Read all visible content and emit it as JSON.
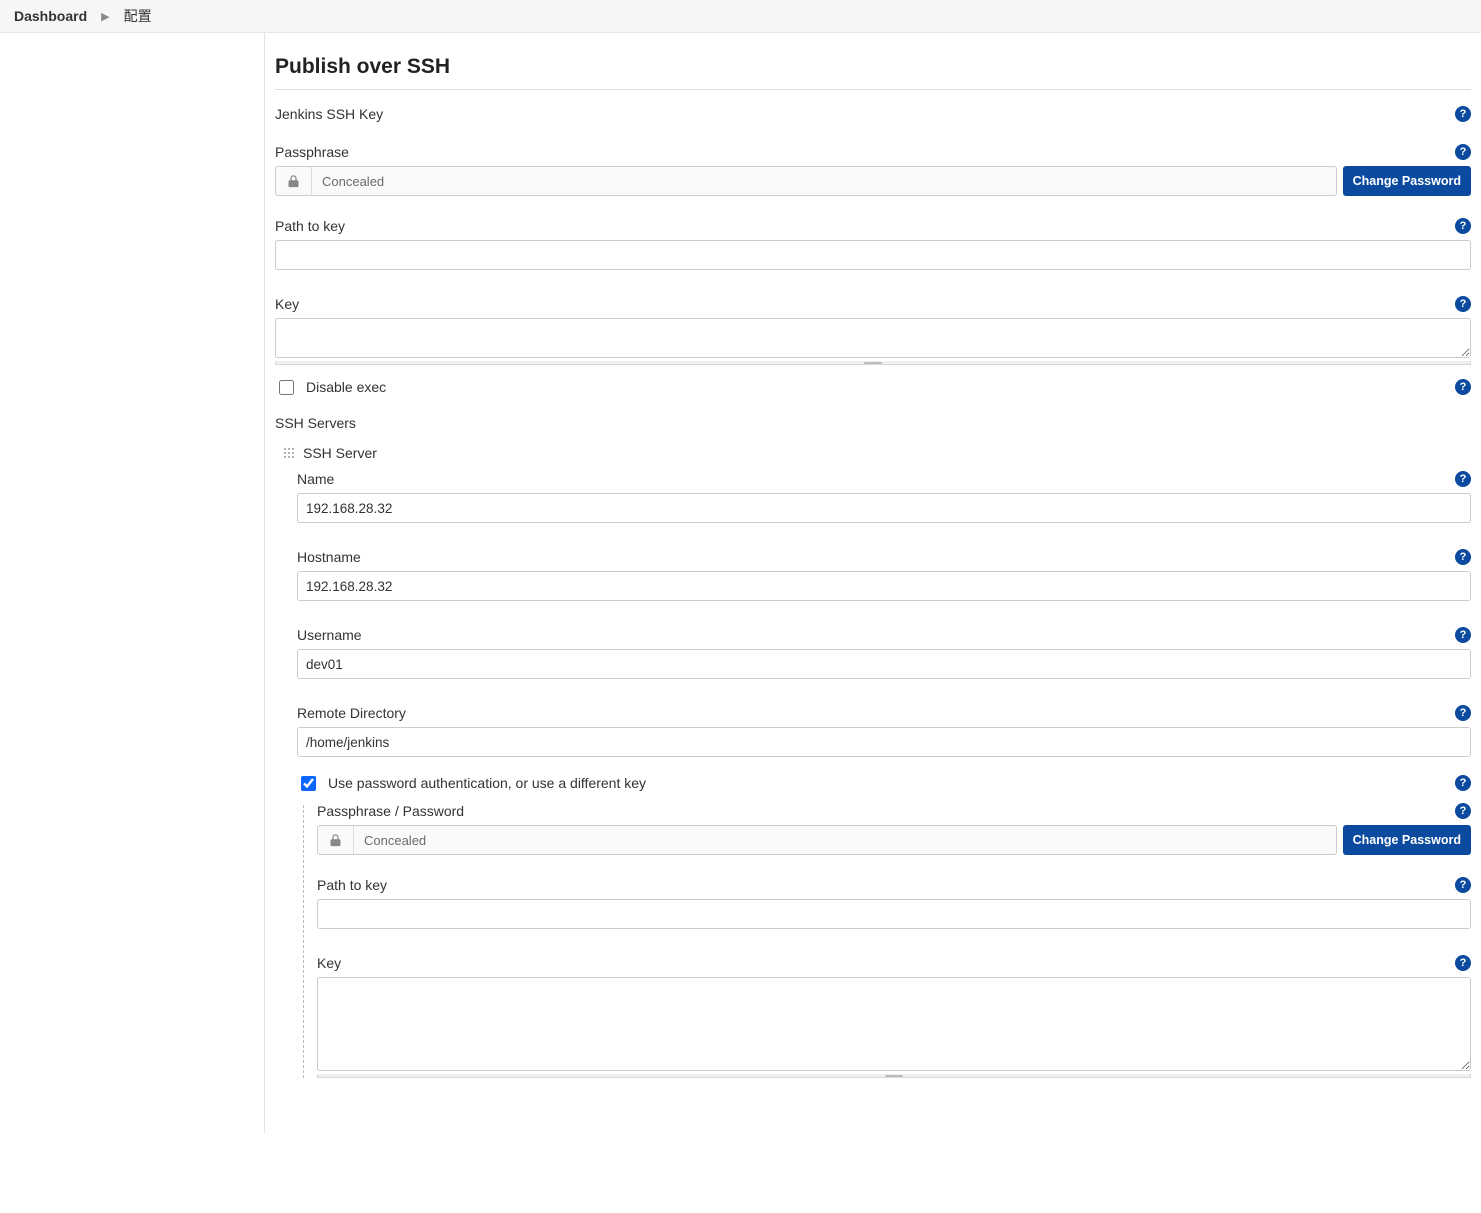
{
  "breadcrumb": {
    "dashboard": "Dashboard",
    "current": "配置"
  },
  "section": {
    "title": "Publish over SSH",
    "jenkinsKeyLabel": "Jenkins SSH Key",
    "passphraseLabel": "Passphrase",
    "concealed": "Concealed",
    "changePassword": "Change Password",
    "pathToKeyLabel": "Path to key",
    "pathToKeyValue": "",
    "keyLabel": "Key",
    "keyValue": "",
    "disableExecLabel": "Disable exec",
    "disableExecChecked": false,
    "sshServersLabel": "SSH Servers"
  },
  "server": {
    "header": "SSH Server",
    "nameLabel": "Name",
    "nameValue": "192.168.28.32",
    "hostnameLabel": "Hostname",
    "hostnameValue": "192.168.28.32",
    "usernameLabel": "Username",
    "usernameValue": "dev01",
    "remoteDirLabel": "Remote Directory",
    "remoteDirValue": "/home/jenkins",
    "usePasswordLabel": "Use password authentication, or use a different key",
    "usePasswordChecked": true,
    "passphrasePasswordLabel": "Passphrase / Password",
    "concealed": "Concealed",
    "changePassword": "Change Password",
    "pathToKeyLabel": "Path to key",
    "pathToKeyValue": "",
    "keyLabel": "Key",
    "keyValue": ""
  }
}
